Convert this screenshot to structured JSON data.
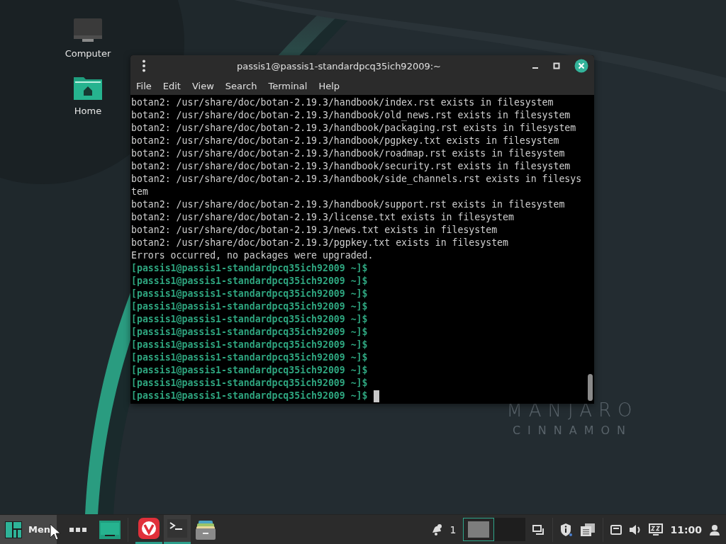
{
  "desktop": {
    "icons": [
      {
        "kind": "computer",
        "label": "Computer"
      },
      {
        "kind": "home",
        "label": "Home"
      }
    ],
    "wallpaper_text": [
      "MANJARO",
      "CINNAMON"
    ]
  },
  "terminal": {
    "title": "passis1@passis1-standardpcq35ich92009:~",
    "menu": [
      "File",
      "Edit",
      "View",
      "Search",
      "Terminal",
      "Help"
    ],
    "lines": [
      {
        "kind": "output",
        "text": "botan2: /usr/share/doc/botan-2.19.3/handbook/index.rst exists in filesystem"
      },
      {
        "kind": "output",
        "text": "botan2: /usr/share/doc/botan-2.19.3/handbook/old_news.rst exists in filesystem"
      },
      {
        "kind": "output",
        "text": "botan2: /usr/share/doc/botan-2.19.3/handbook/packaging.rst exists in filesystem"
      },
      {
        "kind": "output",
        "text": "botan2: /usr/share/doc/botan-2.19.3/handbook/pgpkey.txt exists in filesystem"
      },
      {
        "kind": "output",
        "text": "botan2: /usr/share/doc/botan-2.19.3/handbook/roadmap.rst exists in filesystem"
      },
      {
        "kind": "output",
        "text": "botan2: /usr/share/doc/botan-2.19.3/handbook/security.rst exists in filesystem"
      },
      {
        "kind": "output",
        "text": "botan2: /usr/share/doc/botan-2.19.3/handbook/side_channels.rst exists in filesys"
      },
      {
        "kind": "output",
        "text": "tem"
      },
      {
        "kind": "output",
        "text": "botan2: /usr/share/doc/botan-2.19.3/handbook/support.rst exists in filesystem"
      },
      {
        "kind": "output",
        "text": "botan2: /usr/share/doc/botan-2.19.3/license.txt exists in filesystem"
      },
      {
        "kind": "output",
        "text": "botan2: /usr/share/doc/botan-2.19.3/news.txt exists in filesystem"
      },
      {
        "kind": "output",
        "text": "botan2: /usr/share/doc/botan-2.19.3/pgpkey.txt exists in filesystem"
      },
      {
        "kind": "output",
        "text": "Errors occurred, no packages were upgraded."
      },
      {
        "kind": "prompt",
        "text": "[passis1@passis1-standardpcq35ich92009 ~]$"
      },
      {
        "kind": "prompt",
        "text": "[passis1@passis1-standardpcq35ich92009 ~]$"
      },
      {
        "kind": "prompt",
        "text": "[passis1@passis1-standardpcq35ich92009 ~]$"
      },
      {
        "kind": "prompt",
        "text": "[passis1@passis1-standardpcq35ich92009 ~]$"
      },
      {
        "kind": "prompt",
        "text": "[passis1@passis1-standardpcq35ich92009 ~]$"
      },
      {
        "kind": "prompt",
        "text": "[passis1@passis1-standardpcq35ich92009 ~]$"
      },
      {
        "kind": "prompt",
        "text": "[passis1@passis1-standardpcq35ich92009 ~]$"
      },
      {
        "kind": "prompt",
        "text": "[passis1@passis1-standardpcq35ich92009 ~]$"
      },
      {
        "kind": "prompt",
        "text": "[passis1@passis1-standardpcq35ich92009 ~]$"
      },
      {
        "kind": "prompt",
        "text": "[passis1@passis1-standardpcq35ich92009 ~]$"
      },
      {
        "kind": "prompt",
        "text": "[passis1@passis1-standardpcq35ich92009 ~]$"
      }
    ],
    "cursor": true
  },
  "taskbar": {
    "menu_label": "Men",
    "apps": [
      {
        "kind": "browser",
        "running": true,
        "focused": false
      },
      {
        "kind": "terminal",
        "running": true,
        "focused": true
      },
      {
        "kind": "files",
        "running": false,
        "focused": false
      }
    ],
    "notification_count": "1",
    "workspaces": [
      {
        "selected": true
      },
      {
        "selected": false
      }
    ],
    "clock": "11:00"
  }
}
